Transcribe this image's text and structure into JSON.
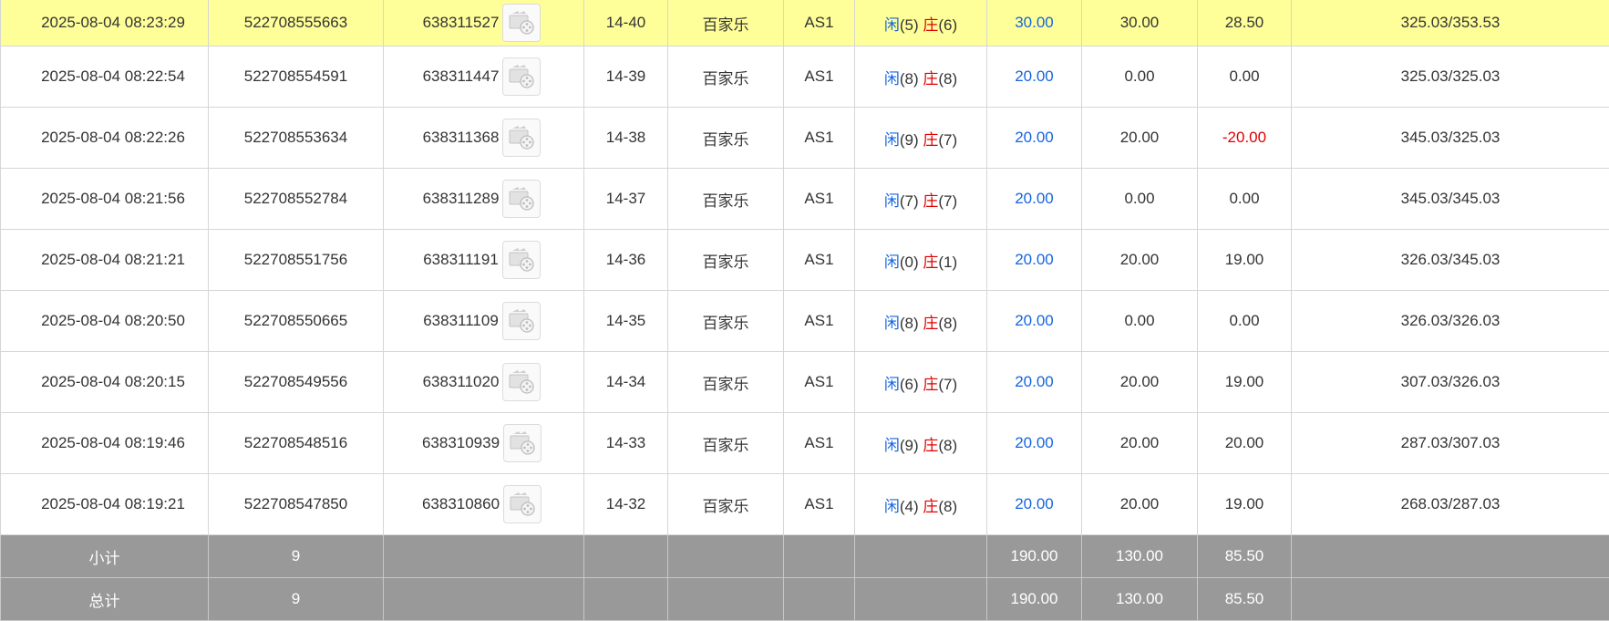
{
  "records": [
    {
      "time": "2025-08-04 08:23:29",
      "bet_id": "522708555663",
      "round_id": "638311527",
      "shoe": "14-40",
      "game": "百家乐",
      "table": "AS1",
      "player_label": "闲",
      "player_score": "(5)",
      "banker_label": "庄",
      "banker_score": "(6)",
      "bet_amount": "30.00",
      "valid_bet": "30.00",
      "win_loss": "28.50",
      "balance": "325.03/353.53",
      "negative": false
    },
    {
      "time": "2025-08-04 08:22:54",
      "bet_id": "522708554591",
      "round_id": "638311447",
      "shoe": "14-39",
      "game": "百家乐",
      "table": "AS1",
      "player_label": "闲",
      "player_score": "(8)",
      "banker_label": "庄",
      "banker_score": "(8)",
      "bet_amount": "20.00",
      "valid_bet": "0.00",
      "win_loss": "0.00",
      "balance": "325.03/325.03",
      "negative": false
    },
    {
      "time": "2025-08-04 08:22:26",
      "bet_id": "522708553634",
      "round_id": "638311368",
      "shoe": "14-38",
      "game": "百家乐",
      "table": "AS1",
      "player_label": "闲",
      "player_score": "(9)",
      "banker_label": "庄",
      "banker_score": "(7)",
      "bet_amount": "20.00",
      "valid_bet": "20.00",
      "win_loss": "-20.00",
      "balance": "345.03/325.03",
      "negative": true
    },
    {
      "time": "2025-08-04 08:21:56",
      "bet_id": "522708552784",
      "round_id": "638311289",
      "shoe": "14-37",
      "game": "百家乐",
      "table": "AS1",
      "player_label": "闲",
      "player_score": "(7)",
      "banker_label": "庄",
      "banker_score": "(7)",
      "bet_amount": "20.00",
      "valid_bet": "0.00",
      "win_loss": "0.00",
      "balance": "345.03/345.03",
      "negative": false
    },
    {
      "time": "2025-08-04 08:21:21",
      "bet_id": "522708551756",
      "round_id": "638311191",
      "shoe": "14-36",
      "game": "百家乐",
      "table": "AS1",
      "player_label": "闲",
      "player_score": "(0)",
      "banker_label": "庄",
      "banker_score": "(1)",
      "bet_amount": "20.00",
      "valid_bet": "20.00",
      "win_loss": "19.00",
      "balance": "326.03/345.03",
      "negative": false
    },
    {
      "time": "2025-08-04 08:20:50",
      "bet_id": "522708550665",
      "round_id": "638311109",
      "shoe": "14-35",
      "game": "百家乐",
      "table": "AS1",
      "player_label": "闲",
      "player_score": "(8)",
      "banker_label": "庄",
      "banker_score": "(8)",
      "bet_amount": "20.00",
      "valid_bet": "0.00",
      "win_loss": "0.00",
      "balance": "326.03/326.03",
      "negative": false
    },
    {
      "time": "2025-08-04 08:20:15",
      "bet_id": "522708549556",
      "round_id": "638311020",
      "shoe": "14-34",
      "game": "百家乐",
      "table": "AS1",
      "player_label": "闲",
      "player_score": "(6)",
      "banker_label": "庄",
      "banker_score": "(7)",
      "bet_amount": "20.00",
      "valid_bet": "20.00",
      "win_loss": "19.00",
      "balance": "307.03/326.03",
      "negative": false
    },
    {
      "time": "2025-08-04 08:19:46",
      "bet_id": "522708548516",
      "round_id": "638310939",
      "shoe": "14-33",
      "game": "百家乐",
      "table": "AS1",
      "player_label": "闲",
      "player_score": "(9)",
      "banker_label": "庄",
      "banker_score": "(8)",
      "bet_amount": "20.00",
      "valid_bet": "20.00",
      "win_loss": "20.00",
      "balance": "287.03/307.03",
      "negative": false
    },
    {
      "time": "2025-08-04 08:19:21",
      "bet_id": "522708547850",
      "round_id": "638310860",
      "shoe": "14-32",
      "game": "百家乐",
      "table": "AS1",
      "player_label": "闲",
      "player_score": "(4)",
      "banker_label": "庄",
      "banker_score": "(8)",
      "bet_amount": "20.00",
      "valid_bet": "20.00",
      "win_loss": "19.00",
      "balance": "268.03/287.03",
      "negative": false
    }
  ],
  "subtotal": {
    "label": "小计",
    "count": "9",
    "bet_amount": "190.00",
    "valid_bet": "130.00",
    "win_loss": "85.50"
  },
  "total": {
    "label": "总计",
    "count": "9",
    "bet_amount": "190.00",
    "valid_bet": "130.00",
    "win_loss": "85.50"
  },
  "icons": {
    "replay": "video-replay-icon"
  },
  "colors": {
    "highlight_row": "#ffff99",
    "player": "#1565e0",
    "banker": "#e00000",
    "negative": "#e00000",
    "summary_bg": "#999999"
  }
}
